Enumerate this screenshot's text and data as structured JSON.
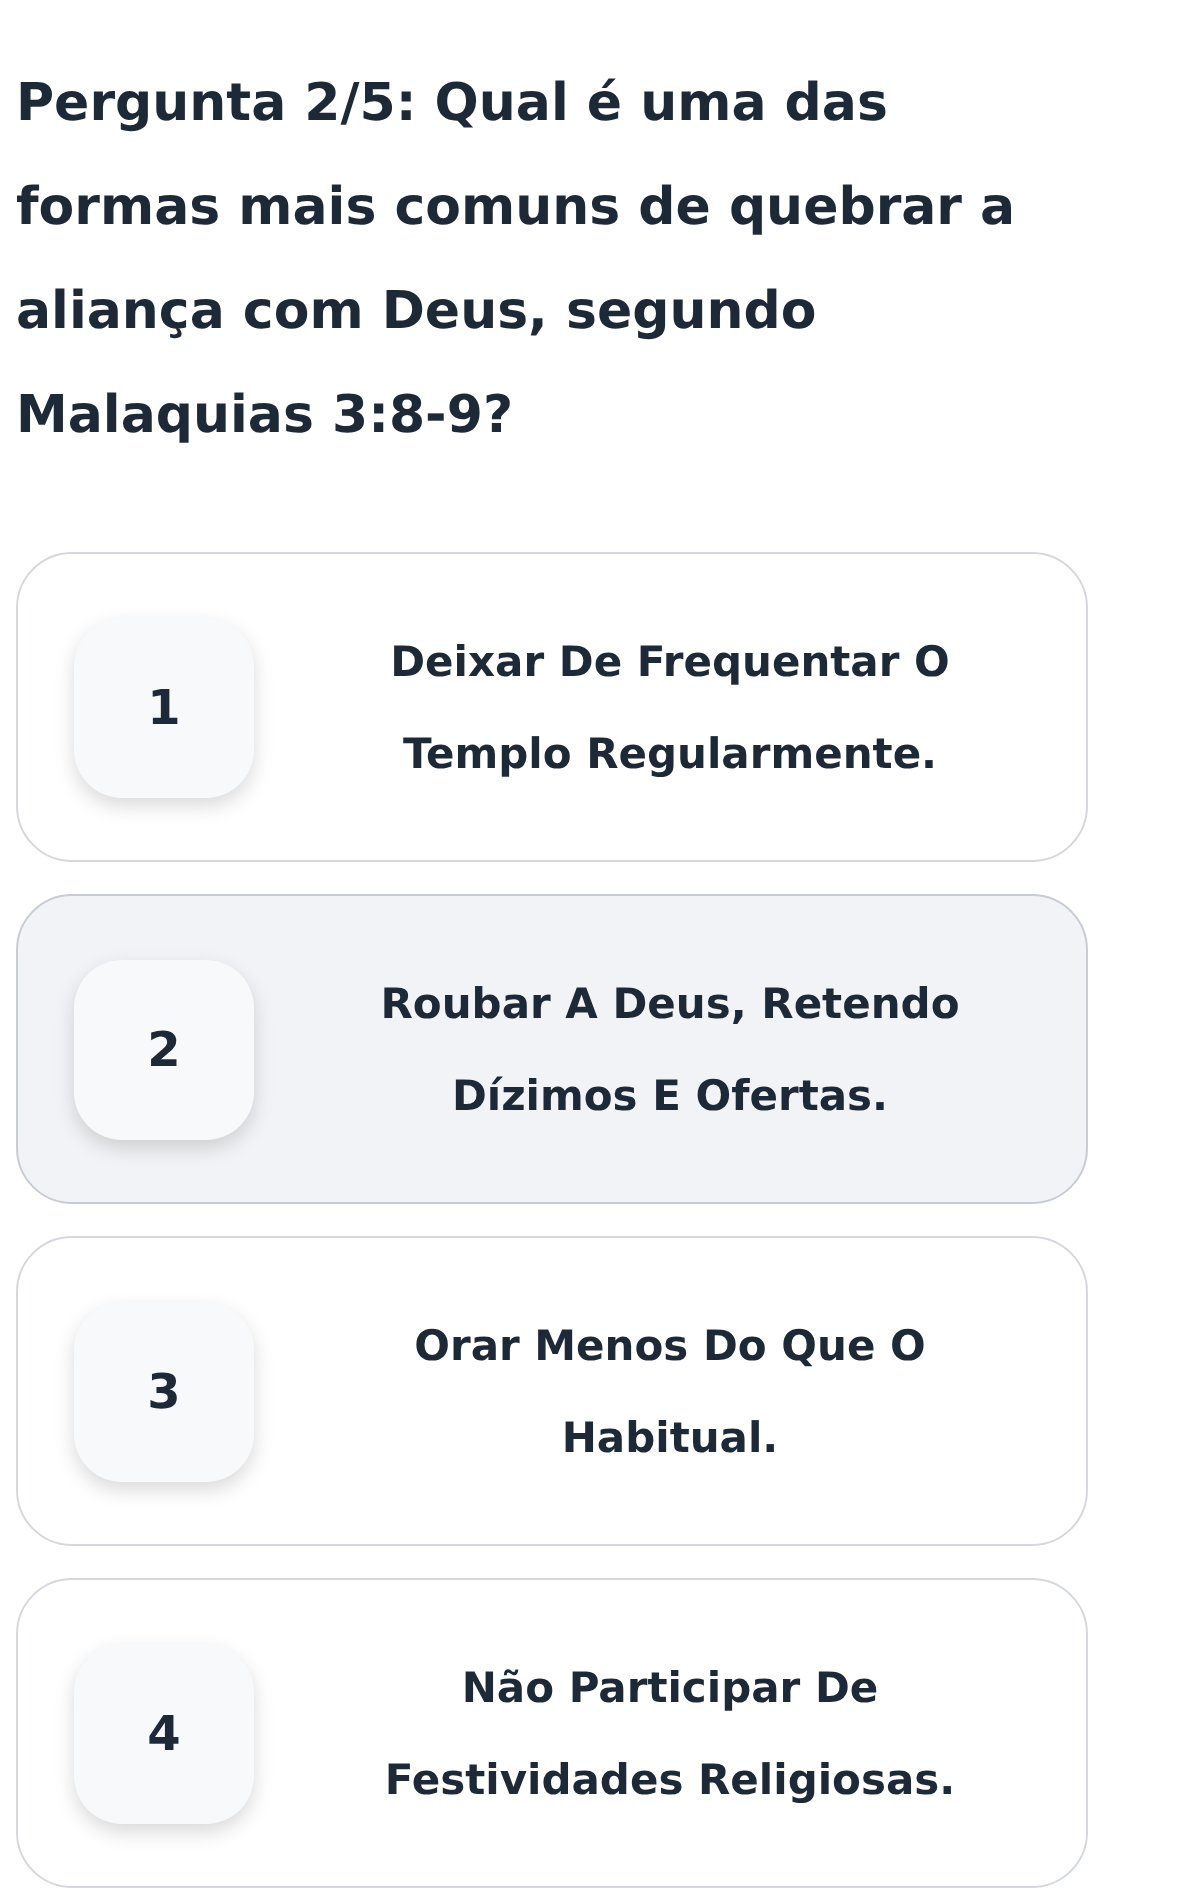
{
  "question": "Pergunta 2/5: Qual é uma das formas mais comuns de quebrar a aliança com Deus, segundo Malaquias 3:8-9?",
  "options": [
    {
      "number": "1",
      "text": "Deixar De Frequentar O Templo Regularmente.",
      "selected": false
    },
    {
      "number": "2",
      "text": "Roubar A Deus, Retendo Dízimos E Ofertas.",
      "selected": true
    },
    {
      "number": "3",
      "text": "Orar Menos Do Que O Habitual.",
      "selected": false
    },
    {
      "number": "4",
      "text": "Não Participar De Festividades Religiosas.",
      "selected": false
    }
  ]
}
